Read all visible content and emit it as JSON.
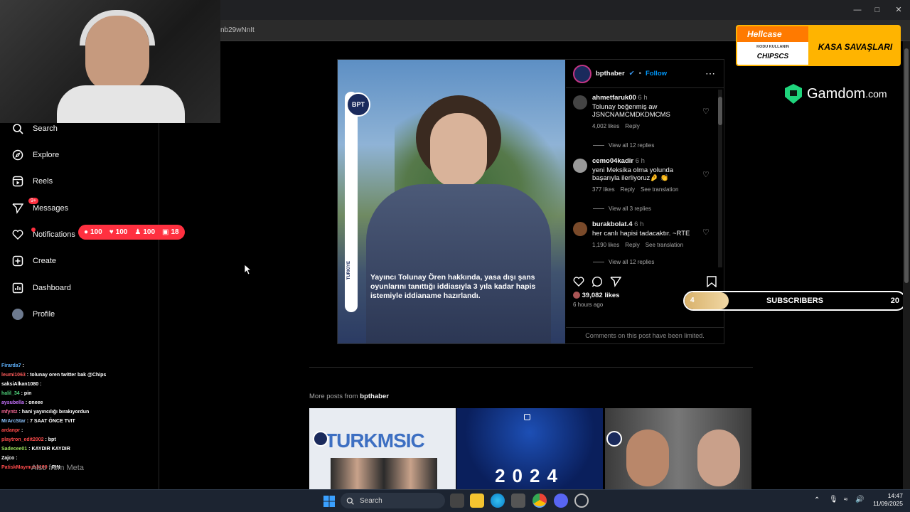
{
  "browser": {
    "url_fragment": "nb29wNnIt"
  },
  "sidebar": {
    "items": [
      {
        "label": "Search",
        "icon": "search-icon"
      },
      {
        "label": "Explore",
        "icon": "compass-icon"
      },
      {
        "label": "Reels",
        "icon": "reels-icon"
      },
      {
        "label": "Messages",
        "icon": "messenger-icon",
        "badge": "9+"
      },
      {
        "label": "Notifications",
        "icon": "heart-icon"
      },
      {
        "label": "Create",
        "icon": "plus-square-icon"
      },
      {
        "label": "Dashboard",
        "icon": "chart-icon"
      },
      {
        "label": "Profile",
        "icon": "avatar-icon"
      }
    ],
    "notification_pill": {
      "comments": "100",
      "likes": "100",
      "follows": "100",
      "tags": "18"
    },
    "also_from_meta": "Also from Meta"
  },
  "chat": [
    {
      "user": "Firarda7",
      "msg": "",
      "color": "#5fb3ff"
    },
    {
      "user": "leumi1063",
      "msg": "tolunay oren twitter bak @Chips",
      "color": "#ff5b5b"
    },
    {
      "user": "saksiAlkan1080",
      "msg": "",
      "color": "#ffffff"
    },
    {
      "user": "halil_34",
      "msg": "pin",
      "color": "#4fd17a"
    },
    {
      "user": "aysubella",
      "msg": "oneee",
      "color": "#c773ff"
    },
    {
      "user": "mfyntz",
      "msg": "hani yayıncılığı bırakıyordun",
      "color": "#ff6b9b"
    },
    {
      "user": "MrArcStar",
      "msg": "7 SAAT ÖNCE TVIT",
      "color": "#8ec5ff"
    },
    {
      "user": "ardanpr",
      "msg": "",
      "color": "#ff4b4b"
    },
    {
      "user": "playtron_edit2002",
      "msg": "bpt",
      "color": "#ff4b4b"
    },
    {
      "user": "Sadecee01",
      "msg": "KAYDIR KAYDIR",
      "color": "#9be15d"
    },
    {
      "user": "Zajco",
      "msg": "",
      "color": "#ffffff"
    },
    {
      "user": "PatiskMaymun3169",
      "msg": "PIN",
      "color": "#ff4b4b"
    }
  ],
  "post": {
    "username": "bpthaber",
    "follow": "Follow",
    "caption": "Yayıncı Tolunay Ören hakkında, yasa dışı şans oyunlarını tanıttığı iddiasıyla 3 yıla kadar hapis istemiyle iddianame hazırlandı.",
    "logo_text": "BPT",
    "strip_text": "TÜRKİYE",
    "comments": [
      {
        "user": "ahmetfaruk00",
        "time": "6 h",
        "text": "Tolunay beğenmiş aw JSNCNAMCMDKDMCMS",
        "likes": "4,002 likes",
        "reply": "Reply",
        "translate": "",
        "view_replies": "View all 12 replies"
      },
      {
        "user": "cemo04kadir",
        "time": "6 h",
        "text": "yeni Meksika olma yolunda başarıyla ilerliyoruz🤌 👏",
        "likes": "377 likes",
        "reply": "Reply",
        "translate": "See translation",
        "view_replies": "View all 3 replies"
      },
      {
        "user": "burakbolat.4",
        "time": "6 h",
        "text": "her canlı hapisi tadacaktır. ~RTE",
        "likes": "1,190 likes",
        "reply": "Reply",
        "translate": "See translation",
        "view_replies": "View all 12 replies"
      }
    ],
    "likes_total": "39,082 likes",
    "posted_ago": "6 hours ago",
    "comments_limited": "Comments on this post have been limited."
  },
  "more_posts": {
    "prefix": "More posts from",
    "user": "bpthaber",
    "thumb1_text": "TURKMSIC",
    "thumb2_text": "2024"
  },
  "overlays": {
    "hellcase_brand": "Hellcase",
    "hellcase_code_label": "KODU KULLANIN",
    "hellcase_code": "CHIPSCS",
    "hellcase_slogan": "KASA SAVAŞLARI",
    "gamdom": "Gamdom",
    "gamdom_suffix": ".com",
    "subs_current": "4",
    "subs_label": "SUBSCRIBERS",
    "subs_goal": "20",
    "subs_progress": 0.2
  },
  "taskbar": {
    "search": "Search",
    "time": "14:47",
    "date": "11/09/2025"
  }
}
